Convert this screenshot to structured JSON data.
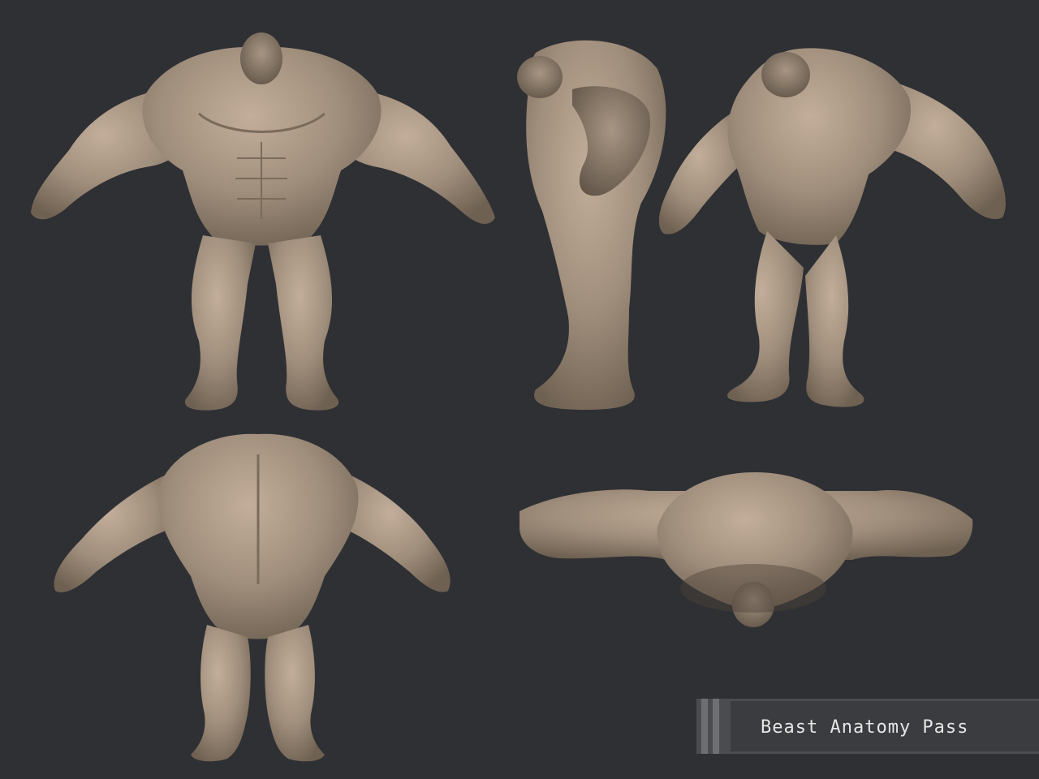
{
  "caption": {
    "text": "Beast Anatomy Pass"
  },
  "views": [
    {
      "name": "front-view"
    },
    {
      "name": "side-view"
    },
    {
      "name": "three-quarter-view"
    },
    {
      "name": "back-view"
    },
    {
      "name": "top-view"
    }
  ],
  "colors": {
    "background": "#2e3034",
    "clay": "#a08e7c",
    "clay_light": "#bca894",
    "clay_shadow": "#6f6152"
  }
}
